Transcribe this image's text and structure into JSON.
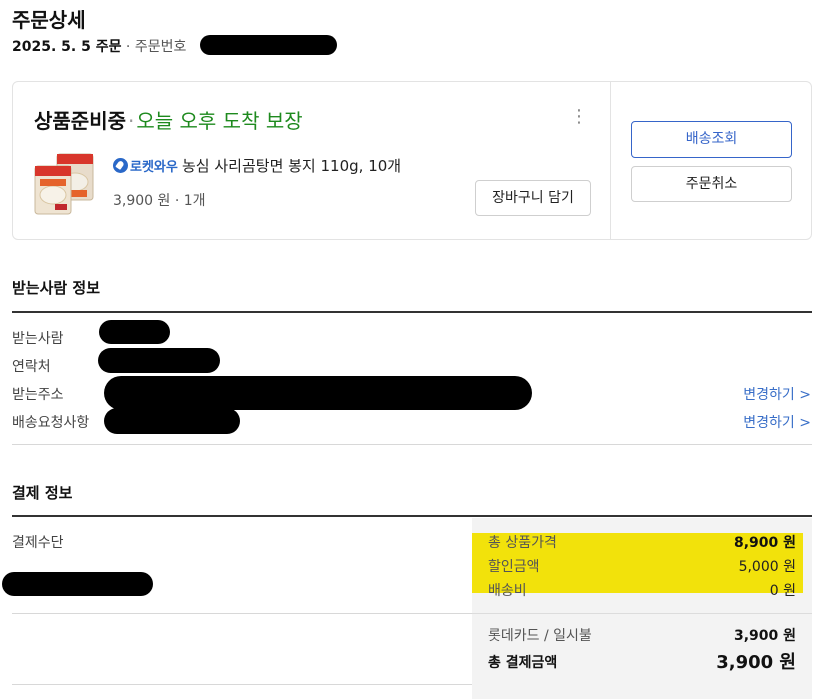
{
  "header": {
    "title": "주문상세",
    "order_date": "2025. 5. 5 주문",
    "order_number_label": "· 주문번호"
  },
  "order_card": {
    "status": "상품준비중",
    "separator": "·",
    "arrival": "오늘 오후 도착 보장",
    "more_icon": "⋮",
    "badge_label": "로켓와우",
    "product_name": "농심 사리곰탕면 봉지 110g, 10개",
    "price_qty": "3,900 원 · 1개",
    "cart_button": "장바구니 담기",
    "track_button": "배송조회",
    "cancel_button": "주문취소"
  },
  "recipient": {
    "title": "받는사람 정보",
    "labels": {
      "name": "받는사람",
      "phone": "연락처",
      "address": "받는주소",
      "request": "배송요청사항"
    },
    "change_address": "변경하기 >",
    "change_request": "변경하기 >"
  },
  "payment": {
    "title": "결제 정보",
    "method_label": "결제수단",
    "rows": [
      {
        "label": "총 상품가격",
        "value": "8,900 원"
      },
      {
        "label": "할인금액",
        "value": "5,000 원"
      },
      {
        "label": "배송비",
        "value": "0 원"
      }
    ],
    "card_label": "롯데카드 / 일시불",
    "card_value": "3,900 원",
    "total_label": "총 결제금액",
    "total_value": "3,900 원"
  },
  "colors": {
    "accent_blue": "#3665c9",
    "arrival_green": "#1e8a1e",
    "highlight_yellow": "#f2e20b"
  }
}
